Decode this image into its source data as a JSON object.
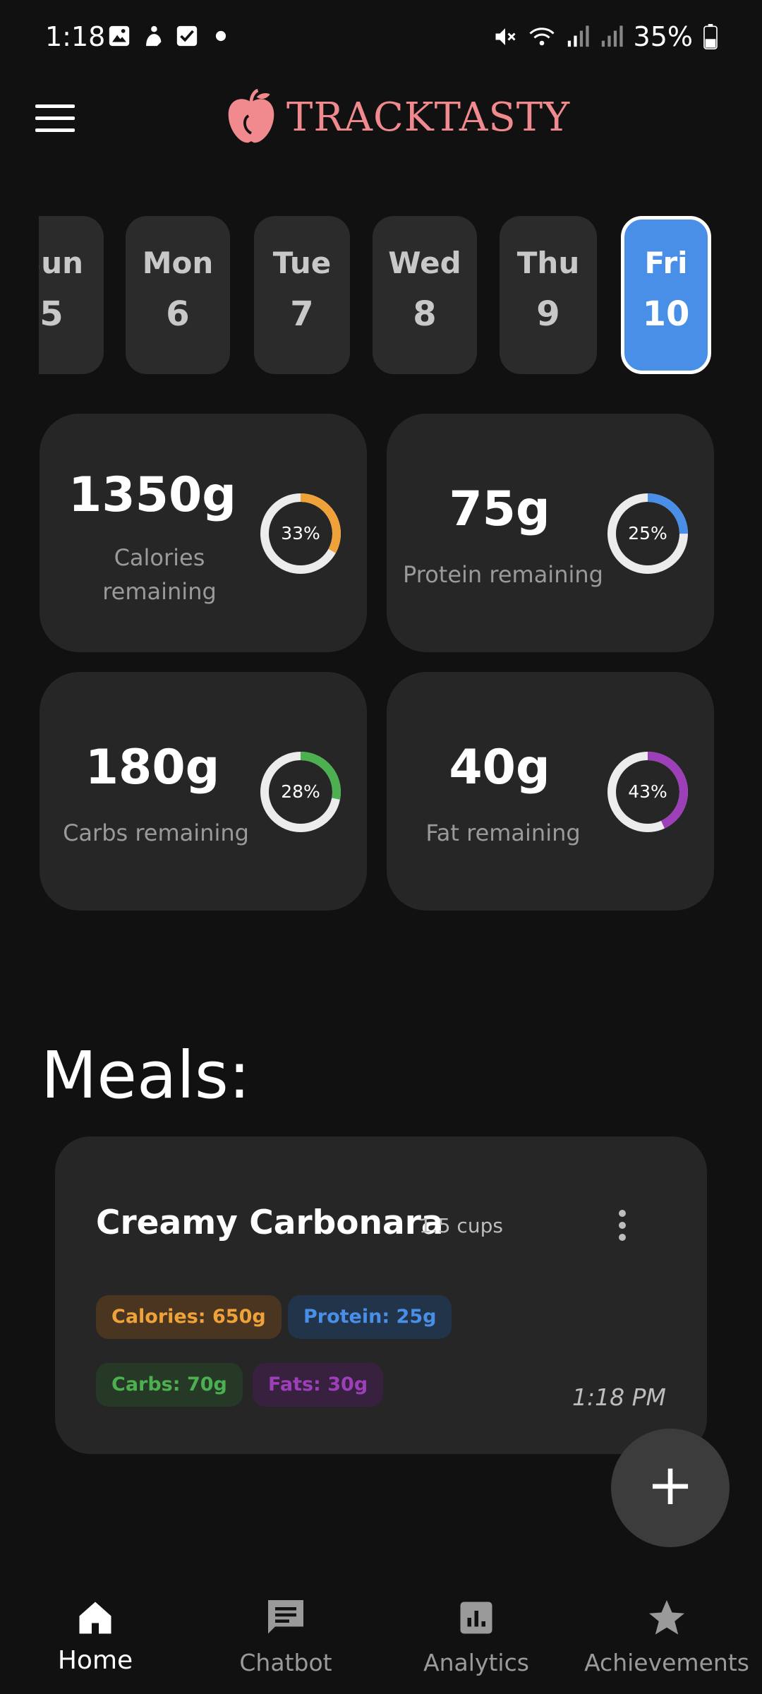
{
  "status_bar": {
    "time": "1:18",
    "battery": "35%"
  },
  "header": {
    "app_name": "TRACKTASTY"
  },
  "days": [
    {
      "name": "Sun",
      "date": "5",
      "selected": false
    },
    {
      "name": "Mon",
      "date": "6",
      "selected": false
    },
    {
      "name": "Tue",
      "date": "7",
      "selected": false
    },
    {
      "name": "Wed",
      "date": "8",
      "selected": false
    },
    {
      "name": "Thu",
      "date": "9",
      "selected": false
    },
    {
      "name": "Fri",
      "date": "10",
      "selected": true
    }
  ],
  "stats": [
    {
      "value": "1350g",
      "label": "Calories remaining",
      "percent_text": "33%",
      "percent": 33,
      "color": "#f0a23a"
    },
    {
      "value": "75g",
      "label": "Protein remaining",
      "percent_text": "25%",
      "percent": 25,
      "color": "#4a8fe7"
    },
    {
      "value": "180g",
      "label": "Carbs remaining",
      "percent_text": "28%",
      "percent": 28,
      "color": "#4caf50"
    },
    {
      "value": "40g",
      "label": "Fat remaining",
      "percent_text": "43%",
      "percent": 43,
      "color": "#9c3fb8"
    }
  ],
  "meals": {
    "title": "Meals:",
    "items": [
      {
        "name": "Creamy Carbonara",
        "quantity": "1.5 cups",
        "calories": "Calories: 650g",
        "protein": "Protein: 25g",
        "carbs": "Carbs: 70g",
        "fats": "Fats: 30g",
        "time": "1:18 PM"
      }
    ]
  },
  "fab": {
    "label": "+"
  },
  "nav": [
    {
      "label": "Home",
      "icon": "home-icon",
      "active": true
    },
    {
      "label": "Chatbot",
      "icon": "chat-icon",
      "active": false
    },
    {
      "label": "Analytics",
      "icon": "analytics-icon",
      "active": false
    },
    {
      "label": "Achievements",
      "icon": "star-icon",
      "active": false
    }
  ],
  "colors": {
    "accent_blue": "#4a8fe7",
    "logo_pink": "#f08a8e",
    "calories": "#f0a23a",
    "protein": "#4a8fe7",
    "carbs": "#4caf50",
    "fats": "#9c3fb8"
  }
}
